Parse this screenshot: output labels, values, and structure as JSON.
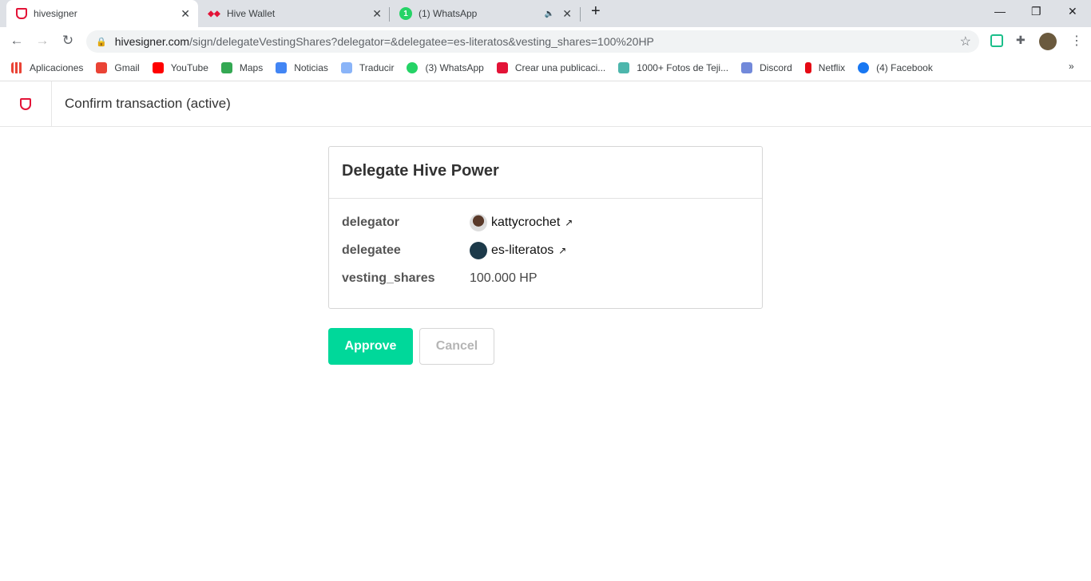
{
  "browser": {
    "tabs": [
      {
        "title": "hivesigner",
        "active": true
      },
      {
        "title": "Hive Wallet"
      },
      {
        "title": "(1) WhatsApp"
      }
    ],
    "url_host": "hivesigner.com",
    "url_path": "/sign/delegateVestingShares?delegator=&delegatee=es-literatos&vesting_shares=100%20HP",
    "bookmarks": [
      "Aplicaciones",
      "Gmail",
      "YouTube",
      "Maps",
      "Noticias",
      "Traducir",
      "(3) WhatsApp",
      "Crear una publicaci...",
      "1000+ Fotos de Teji...",
      "Discord",
      "Netflix",
      "(4) Facebook"
    ]
  },
  "app": {
    "header_title": "Confirm transaction (active)",
    "brand_color": "#e31337"
  },
  "card": {
    "title": "Delegate Hive Power",
    "rows": [
      {
        "key": "delegator",
        "value": "kattycrochet"
      },
      {
        "key": "delegatee",
        "value": "es-literatos"
      },
      {
        "key": "vesting_shares",
        "value": "100.000 HP"
      }
    ]
  },
  "actions": {
    "approve": "Approve",
    "cancel": "Cancel",
    "approve_color": "#00d89a"
  }
}
